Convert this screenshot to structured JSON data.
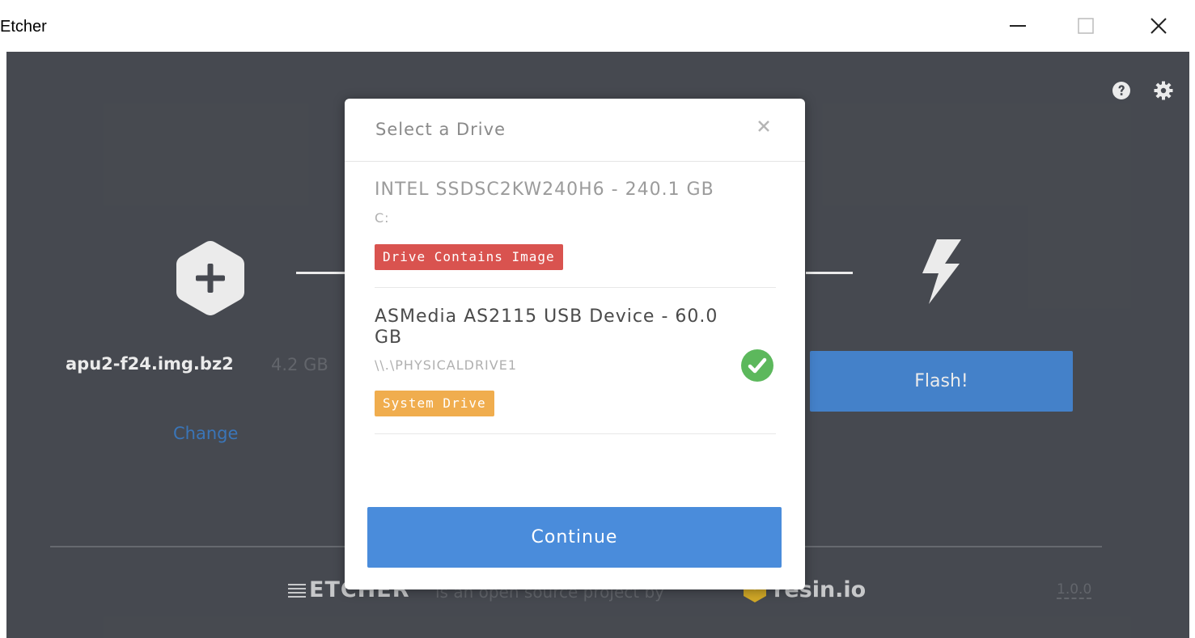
{
  "window": {
    "title": "Etcher",
    "minimize_glyph": "—",
    "maximize_glyph": "☐",
    "close_glyph": "✕"
  },
  "toolbar": {
    "help_icon": "help-icon",
    "settings_icon": "gear-icon"
  },
  "image_step": {
    "icon": "plus-hexagon-icon",
    "filename": "apu2-f24.img.bz2",
    "size": "4.2 GB",
    "change_label": "Change"
  },
  "flash_step": {
    "icon": "lightning-bolt-icon",
    "button_label": "Flash!"
  },
  "footer": {
    "brand": "ETCHER",
    "tagline": "is an open source project by",
    "company": "resin.io",
    "version": "1.0.0"
  },
  "modal": {
    "title": "Select a Drive",
    "close_glyph": "×",
    "drives": [
      {
        "name": "INTEL SSDSC2KW240H6 - 240.1 GB",
        "path": "C:",
        "badge": "Drive Contains Image",
        "badge_color": "#d9534f",
        "selected": false,
        "disabled": true
      },
      {
        "name": "ASMedia AS2115 USB Device - 60.0 GB",
        "path": "\\\\.\\PHYSICALDRIVE1",
        "badge": "System Drive",
        "badge_color": "#f0ad4e",
        "selected": true,
        "disabled": false
      }
    ],
    "continue_label": "Continue"
  },
  "colors": {
    "app_background": "#4d5057",
    "accent_blue": "#4a8cdb",
    "link_blue": "#3f7fc8",
    "check_green": "#5cb85c"
  }
}
